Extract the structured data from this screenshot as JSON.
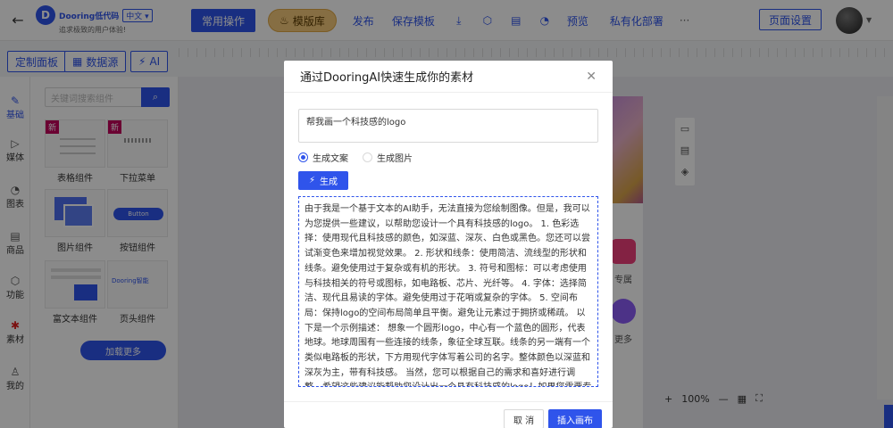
{
  "header": {
    "back_icon": "arrow-left-icon",
    "brand": "Dooring低代码",
    "lang": "中文",
    "slogan": "追求极致的用户体验!",
    "toolbar": {
      "common_ops": "常用操作",
      "template_lib": "模版库",
      "publish": "发布",
      "save_template": "保存模板",
      "preview": "预览",
      "private_deploy": "私有化部署",
      "more": "···"
    },
    "page_settings": "页面设置"
  },
  "left_tabs": {
    "custom_panel": "定制面板",
    "data_source": "数据源",
    "ai": "AI"
  },
  "sidenav": [
    {
      "label": "基础",
      "icon": "brush-icon"
    },
    {
      "label": "媒体",
      "icon": "play-icon"
    },
    {
      "label": "图表",
      "icon": "pie-chart-icon"
    },
    {
      "label": "商品",
      "icon": "shop-icon"
    },
    {
      "label": "功能",
      "icon": "cube-icon"
    },
    {
      "label": "素材",
      "icon": "asset-icon"
    },
    {
      "label": "我的",
      "icon": "user-icon"
    }
  ],
  "panel": {
    "search_placeholder": "关键词搜索组件",
    "new_badge": "新",
    "cards": [
      {
        "label": "表格组件"
      },
      {
        "label": "下拉菜单"
      },
      {
        "label": "图片组件"
      },
      {
        "label": "按钮组件",
        "thumb_text": "Button"
      },
      {
        "label": "富文本组件"
      },
      {
        "label": "页头组件",
        "thumb_text": "Dooring智能"
      }
    ],
    "load_more": "加载更多"
  },
  "canvas": {
    "tile1_text": "专属",
    "tile2_text": "更多",
    "zoom": "100%",
    "zoom_plus": "+",
    "zoom_minus": "—"
  },
  "modal": {
    "title": "通过DooringAI快速生成你的素材",
    "prompt_value": "帮我画一个科技感的logo",
    "radio_text": "生成文案",
    "radio_image": "生成图片",
    "generate": "生成",
    "result": "由于我是一个基于文本的AI助手，无法直接为您绘制图像。但是，我可以为您提供一些建议，以帮助您设计一个具有科技感的logo。 1. 色彩选择：使用现代且科技感的颜色，如深蓝、深灰、白色或黑色。您还可以尝试渐变色来增加视觉效果。 2. 形状和线条：使用简洁、流线型的形状和线条。避免使用过于复杂或有机的形状。 3. 符号和图标：可以考虑使用与科技相关的符号或图标，如电路板、芯片、光纤等。 4. 字体：选择简洁、现代且易读的字体。避免使用过于花哨或复杂的字体。 5. 空间布局：保持logo的空间布局简单且平衡。避免让元素过于拥挤或稀疏。 以下是一个示例描述： 想象一个圆形logo，中心有一个蓝色的圆形，代表地球。地球周围有一些连接的线条，象征全球互联。线条的另一端有一个类似电路板的形状，下方用现代字体写着公司的名字。整体颜色以深蓝和深灰为主，带有科技感。 当然，您可以根据自己的需求和喜好进行调整。希望这些建议能帮助您设计出一个具有科技感的logo！如果您需要专业的设计服务，建议您咨询专业的设计师。",
    "cancel": "取 消",
    "insert": "插入画布"
  },
  "colors": {
    "primary": "#2f54eb",
    "template_btn": "#f5c97b",
    "badge": "#c4005c"
  }
}
